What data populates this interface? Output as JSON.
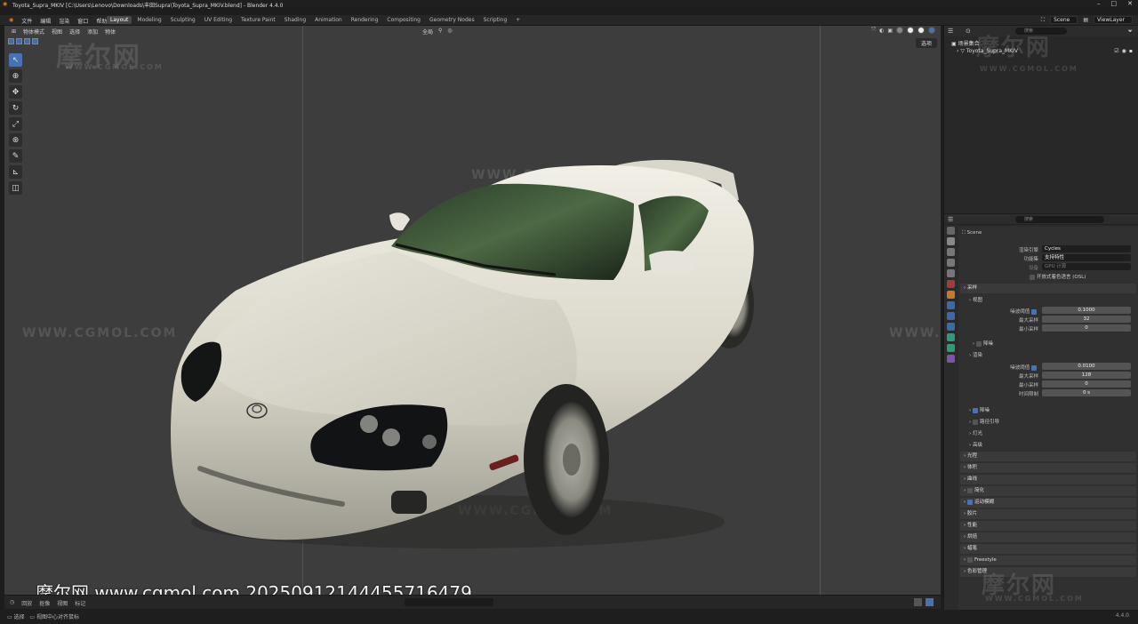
{
  "window": {
    "title": "Toyota_Supra_MKIV [C:\\Users\\Lenovo\\Downloads\\丰田Supra\\Toyota_Supra_MKIV.blend] - Blender 4.4.0",
    "controls": [
      "–",
      "□",
      "✕"
    ]
  },
  "topbar": {
    "menus": [
      "文件",
      "编辑",
      "渲染",
      "窗口",
      "帮助"
    ],
    "workspaces": [
      "Layout",
      "Modeling",
      "Sculpting",
      "UV Editing",
      "Texture Paint",
      "Shading",
      "Animation",
      "Rendering",
      "Compositing",
      "Geometry Nodes",
      "Scripting",
      "+"
    ],
    "active_workspace": "Layout",
    "scene": "Scene",
    "view_layer": "ViewLayer"
  },
  "viewport": {
    "mode": "物体模式",
    "menus": [
      "视图",
      "选择",
      "添加",
      "物体"
    ],
    "transform": "全局",
    "view_button": "选项",
    "tools": [
      "select-box-icon",
      "cursor-icon",
      "move-icon",
      "rotate-icon",
      "scale-icon",
      "transform-icon",
      "annotate-icon",
      "measure-icon",
      "add-cube-icon"
    ]
  },
  "watermarks": {
    "logo": "摩尔网",
    "site": "WWW.CGMOL.COM"
  },
  "stamp": "摩尔网 www.cgmol.com 20250912144455716479",
  "timeline": {
    "menus": [
      "回放",
      "抠像",
      "视图",
      "标记"
    ]
  },
  "status": {
    "left": "选择",
    "hint": "视图中心对齐鼠标",
    "version": "4.4.0"
  },
  "outliner": {
    "search_placeholder": "搜索",
    "rows": [
      "场景集合",
      "Toyota_Supra_MKIV"
    ]
  },
  "properties": {
    "search_placeholder": "搜索",
    "scene_label": "Scene",
    "render_engine_label": "渲染引擎",
    "render_engine": "Cycles",
    "feature_set_label": "功能集",
    "feature_set": "支持特性",
    "device_label": "设备",
    "device": "GPU 计算",
    "osl": "开放式着色语言 (OSL)",
    "sampling": "采样",
    "viewport": "视图",
    "noise_threshold_label": "噪波阈值",
    "vp_noise_threshold": "0.1000",
    "max_samples_label": "最大采样",
    "vp_max_samples": "32",
    "min_samples_label": "最小采样",
    "vp_min_samples": "0",
    "denoise": "降噪",
    "render": "渲染",
    "r_noise_threshold": "0.0100",
    "r_max_samples": "128",
    "r_min_samples": "0",
    "time_limit_label": "时间限制",
    "r_time_limit": "0 s",
    "sub_panels": [
      "降噪",
      "路径引导",
      "灯光",
      "高级"
    ],
    "panels": [
      "光程",
      "体积",
      "曲线",
      "简化",
      "运动模糊",
      "胶片",
      "性能",
      "烘焙",
      "蜡笔",
      "Freestyle",
      "色彩管理"
    ]
  }
}
